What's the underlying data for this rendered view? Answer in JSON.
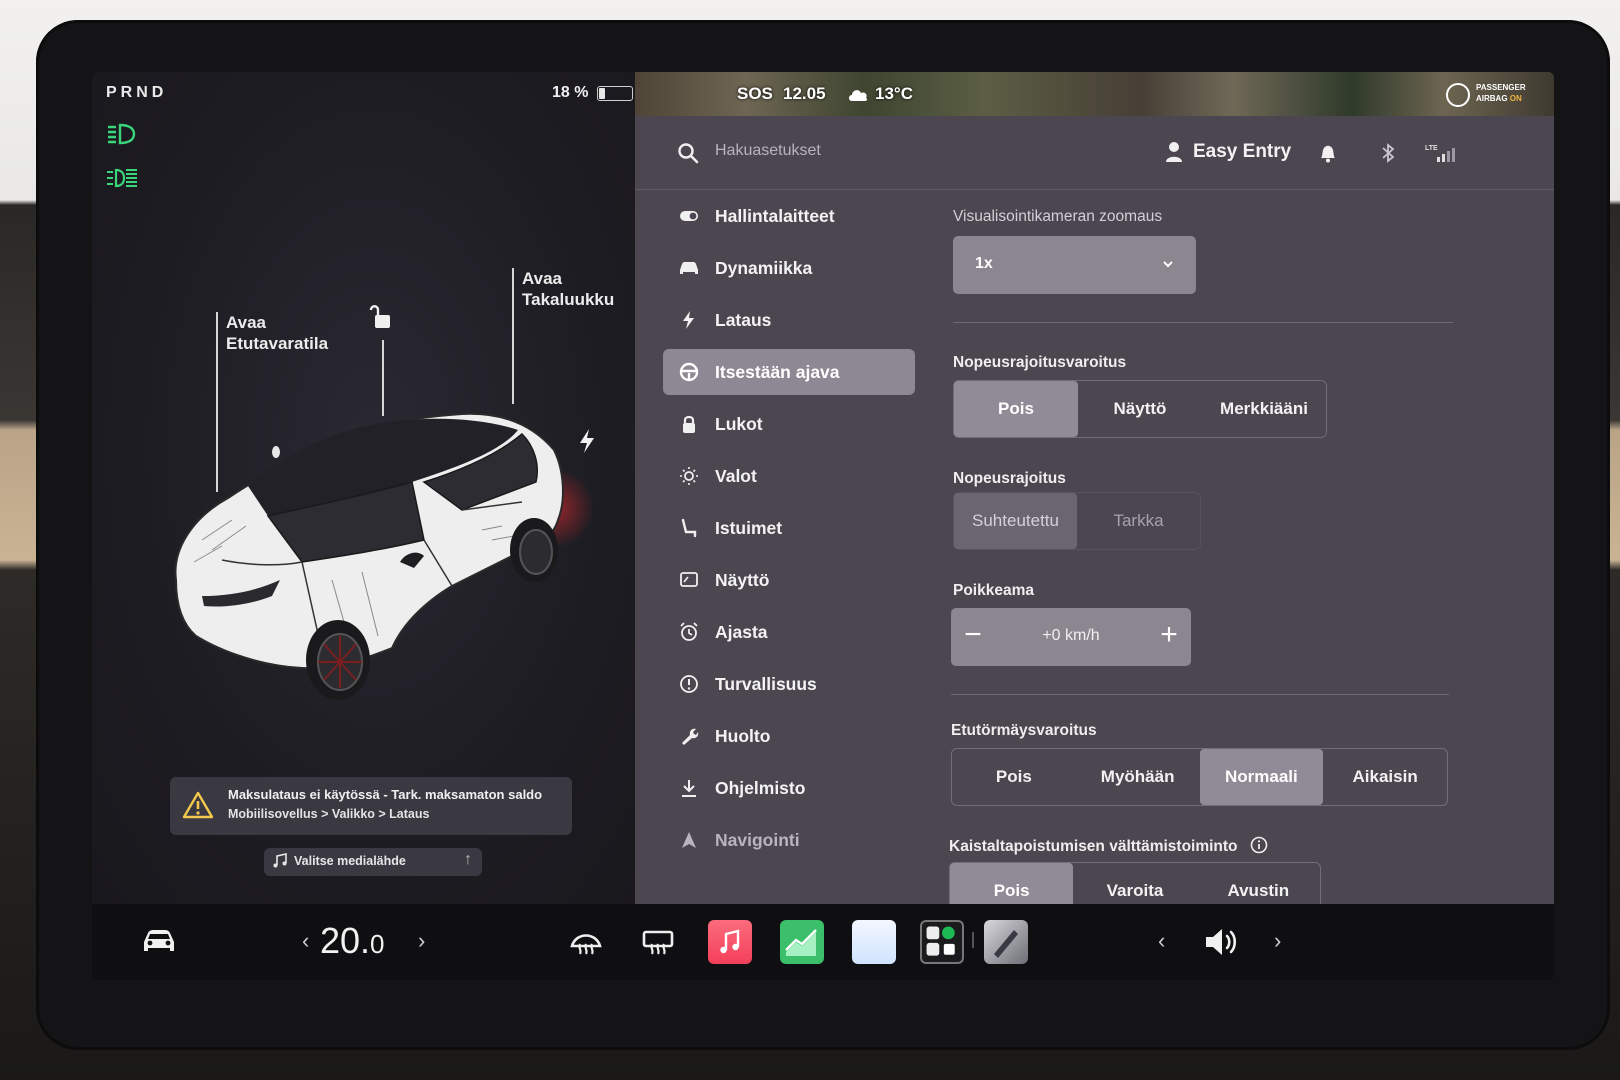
{
  "left": {
    "gear": "PRND",
    "battery_pct": "18 %",
    "battery_level": 0.18,
    "frunk_label": [
      "Avaa",
      "Etutavaratila"
    ],
    "trunk_label": [
      "Avaa",
      "Takaluukku"
    ],
    "alert": {
      "line1": "Maksulataus ei käytössä - Tark. maksamaton saldo",
      "line2": "Mobiilisovellus > Valikko > Lataus",
      "icon": "warning-icon"
    },
    "media_label": "Valitse medialähde"
  },
  "status": {
    "sos": "SOS",
    "time": "12.05",
    "temperature": "13°C",
    "airbag_line1": "PASSENGER",
    "airbag_line2a": "AIRBAG ",
    "airbag_line2b": "ON"
  },
  "header": {
    "search_placeholder": "Hakuasetukset",
    "profile_name": "Easy Entry"
  },
  "nav": [
    {
      "label": "Hallintalaitteet",
      "icon": "toggle-icon"
    },
    {
      "label": "Dynamiikka",
      "icon": "car-icon"
    },
    {
      "label": "Lataus",
      "icon": "bolt-icon"
    },
    {
      "label": "Itsestään ajava",
      "icon": "steering-wheel-icon",
      "active": true
    },
    {
      "label": "Lukot",
      "icon": "lock-icon"
    },
    {
      "label": "Valot",
      "icon": "sun-icon"
    },
    {
      "label": "Istuimet",
      "icon": "seat-icon"
    },
    {
      "label": "Näyttö",
      "icon": "display-icon"
    },
    {
      "label": "Ajasta",
      "icon": "alarm-clock-icon"
    },
    {
      "label": "Turvallisuus",
      "icon": "info-circle-icon"
    },
    {
      "label": "Huolto",
      "icon": "wrench-icon"
    },
    {
      "label": "Ohjelmisto",
      "icon": "download-icon"
    },
    {
      "label": "Navigointi",
      "icon": "navigation-icon"
    }
  ],
  "settings": {
    "zoom_label": "Visualisointikameran zoomaus",
    "zoom_value": "1x",
    "speed_warning_label": "Nopeusrajoitusvaroitus",
    "speed_warning_options": [
      "Pois",
      "Näyttö",
      "Merkkiääni"
    ],
    "speed_limit_label": "Nopeusrajoitus",
    "speed_limit_options": [
      "Suhteutettu",
      "Tarkka"
    ],
    "offset_label": "Poikkeama",
    "offset_value": "+0 km/h",
    "collision_label": "Etutörmäysvaroitus",
    "collision_options": [
      "Pois",
      "Myöhään",
      "Normaali",
      "Aikaisin"
    ],
    "lane_label": "Kaistaltapoistumisen välttämistoiminto",
    "lane_options": [
      "Pois",
      "Varoita",
      "Avustin"
    ]
  },
  "dock": {
    "temperature": "20.",
    "temperature_decimal": "0"
  }
}
